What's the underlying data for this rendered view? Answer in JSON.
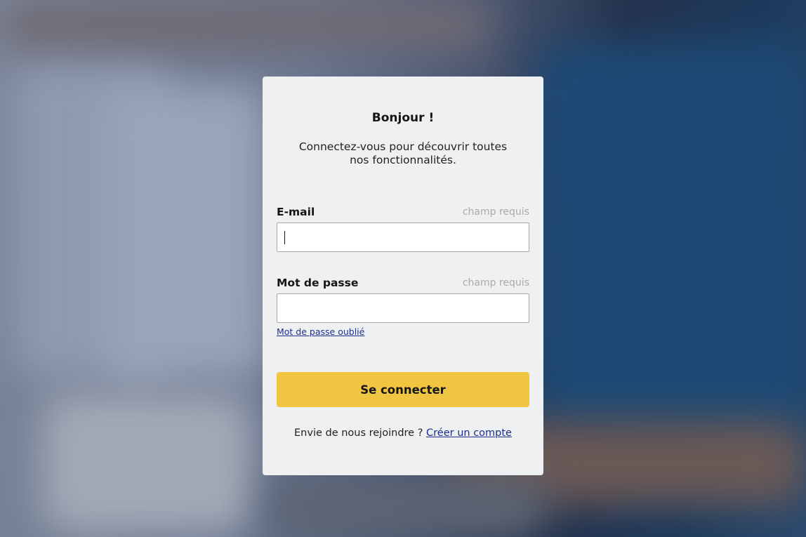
{
  "login": {
    "title": "Bonjour !",
    "subtitle": "Connectez-vous pour découvrir toutes nos fonctionnalités.",
    "email": {
      "label": "E-mail",
      "hint": "champ requis",
      "value": ""
    },
    "password": {
      "label": "Mot de passe",
      "hint": "champ requis",
      "value": ""
    },
    "forgot_password": "Mot de passe oublié",
    "submit_label": "Se connecter",
    "signup_prompt": "Envie de nous rejoindre ? ",
    "signup_link": "Créer un compte"
  },
  "colors": {
    "accent": "#f0c541",
    "link": "#1c2f8c",
    "card": "#eff0f2",
    "hint": "#aaaaaa"
  }
}
